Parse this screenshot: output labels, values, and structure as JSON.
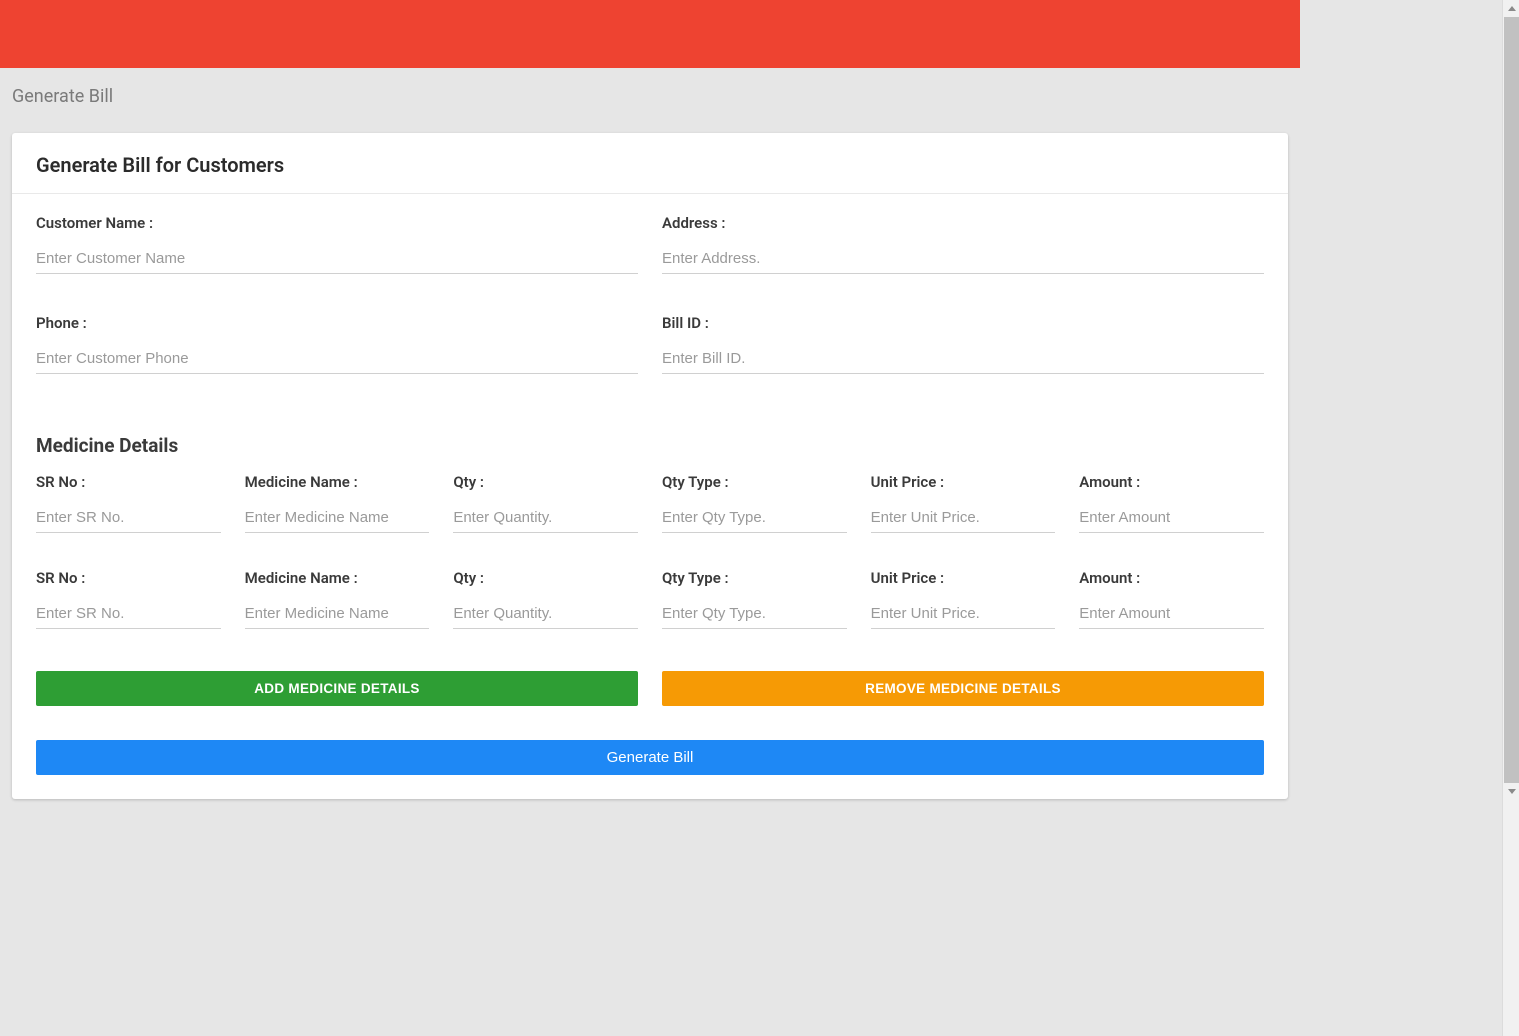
{
  "breadcrumb": "Generate Bill",
  "card": {
    "title": "Generate Bill for Customers"
  },
  "customer": {
    "name_label": "Customer Name :",
    "name_placeholder": "Enter Customer Name",
    "address_label": "Address :",
    "address_placeholder": "Enter Address.",
    "phone_label": "Phone :",
    "phone_placeholder": "Enter Customer Phone",
    "bill_id_label": "Bill ID :",
    "bill_id_placeholder": "Enter Bill ID."
  },
  "medicine": {
    "section_title": "Medicine Details",
    "columns": {
      "sr_no": "SR No :",
      "medicine_name": "Medicine Name :",
      "qty": "Qty :",
      "qty_type": "Qty Type :",
      "unit_price": "Unit Price :",
      "amount": "Amount :"
    },
    "placeholders": {
      "sr_no": "Enter SR No.",
      "medicine_name": "Enter Medicine Name",
      "qty": "Enter Quantity.",
      "qty_type": "Enter Qty Type.",
      "unit_price": "Enter Unit Price.",
      "amount": "Enter Amount"
    },
    "rows": [
      {
        "sr_no": "",
        "medicine_name": "",
        "qty": "",
        "qty_type": "",
        "unit_price": "",
        "amount": ""
      },
      {
        "sr_no": "",
        "medicine_name": "",
        "qty": "",
        "qty_type": "",
        "unit_price": "",
        "amount": ""
      }
    ]
  },
  "buttons": {
    "add": "ADD MEDICINE DETAILS",
    "remove": "REMOVE MEDICINE DETAILS",
    "generate": "Generate Bill"
  },
  "colors": {
    "banner": "#ee4331",
    "green": "#2e9e34",
    "orange": "#f69a05",
    "blue": "#1e88f5"
  }
}
